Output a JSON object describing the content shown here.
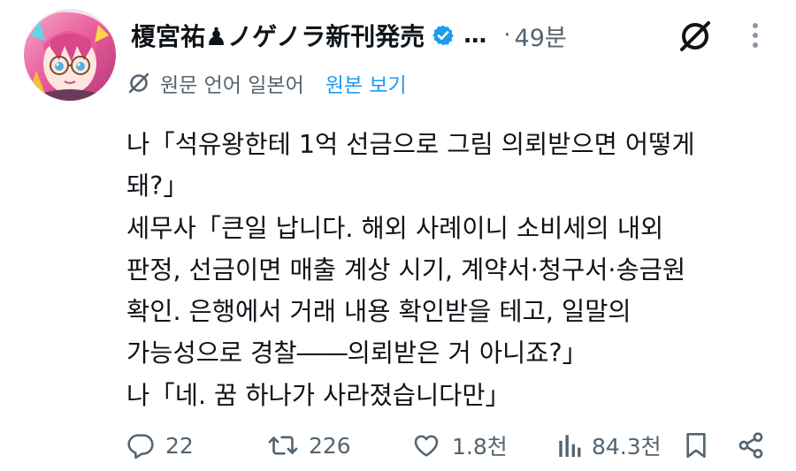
{
  "author": {
    "name": "榎宮祐♟ノゲノラ新刊発売",
    "ellipsis": "…",
    "time_separator": "·",
    "time": "49분"
  },
  "translation": {
    "label": "원문 언어 일본어",
    "show_original": "원본 보기"
  },
  "tweet": {
    "lines": [
      "나「석유왕한테 1억 선금으로 그림 의뢰받으면 어떻게",
      "돼?」",
      "세무사「큰일 납니다. 해외 사례이니 소비세의 내외",
      "판정, 선금이면 매출 계상 시기, 계약서·청구서·송금원",
      "확인. 은행에서 거래 내용 확인받을 테고, 일말의",
      "가능성으로 경찰――의뢰받은 거 아니죠?」",
      "나「네. 꿈 하나가 사라졌습니다만」"
    ]
  },
  "actions": {
    "replies": "22",
    "reposts": "226",
    "likes": "1.8천",
    "views": "84.3천"
  },
  "icons": {
    "verified": "verified-badge-icon",
    "grok": "grok-icon",
    "more": "more-vertical-icon",
    "reply": "reply-icon",
    "repost": "repost-icon",
    "like": "heart-icon",
    "views": "views-icon",
    "bookmark": "bookmark-icon",
    "share": "share-icon"
  },
  "colors": {
    "text": "#0f1419",
    "secondary": "#536471",
    "link": "#1d9bf0",
    "verified": "#1d9bf0"
  }
}
